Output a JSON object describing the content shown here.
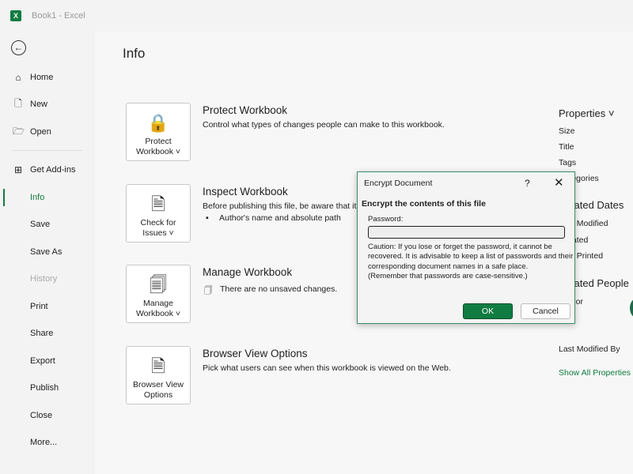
{
  "titlebar": {
    "app_icon": "excel-icon",
    "title": "Book1  -  Excel"
  },
  "sidebar": {
    "back_icon": "back-arrow-icon",
    "items": [
      {
        "label": "Home",
        "icon": "home-icon"
      },
      {
        "label": "New",
        "icon": "new-document-icon"
      },
      {
        "label": "Open",
        "icon": "folder-open-icon"
      },
      {
        "label": "Get Add-ins",
        "icon": "addins-grid-icon"
      },
      {
        "label": "Info",
        "active": true
      },
      {
        "label": "Save"
      },
      {
        "label": "Save As"
      },
      {
        "label": "History",
        "disabled": true
      },
      {
        "label": "Print"
      },
      {
        "label": "Share"
      },
      {
        "label": "Export"
      },
      {
        "label": "Publish"
      },
      {
        "label": "Close"
      },
      {
        "label": "More..."
      }
    ]
  },
  "main": {
    "title": "Info",
    "sections": [
      {
        "button": [
          "Protect",
          "Workbook ˅"
        ],
        "title": "Protect Workbook",
        "desc": "Control what types of changes people can make to this workbook."
      },
      {
        "button": [
          "Check for",
          "Issues ˅"
        ],
        "title": "Inspect Workbook",
        "desc": "Before publishing this file, be aware that it contains:",
        "bullet": "Author's name and absolute path"
      },
      {
        "button": [
          "Manage",
          "Workbook ˅"
        ],
        "title": "Manage Workbook",
        "desc": "There are no unsaved changes."
      },
      {
        "button": [
          "Browser View",
          "Options"
        ],
        "title": "Browser View Options",
        "desc": "Pick what users can see when this workbook is viewed on the Web."
      }
    ]
  },
  "properties": {
    "title": "Properties ˅",
    "size": "Size",
    "title_label": "Title",
    "tags": "Tags",
    "categories": "Categories",
    "related_dates": "Related Dates",
    "last_modified": "Last Modified",
    "created": "Created",
    "last_printed": "Last Printed",
    "related_people": "Related People",
    "author": "Author",
    "last_modified_by": "Last Modified By",
    "show_all": "Show All Properties"
  },
  "dialog": {
    "title": "Encrypt Document",
    "help": "?",
    "close": "✕",
    "heading": "Encrypt the contents of this file",
    "password_label": "Password:",
    "password_value": "",
    "caution": "Caution: If you lose or forget the password, it cannot be recovered. It is advisable to keep a list of passwords and their corresponding document names in a safe place.",
    "reminder": "(Remember that passwords are case-sensitive.)",
    "ok": "OK",
    "cancel": "Cancel"
  },
  "colors": {
    "accent": "#107c41"
  }
}
